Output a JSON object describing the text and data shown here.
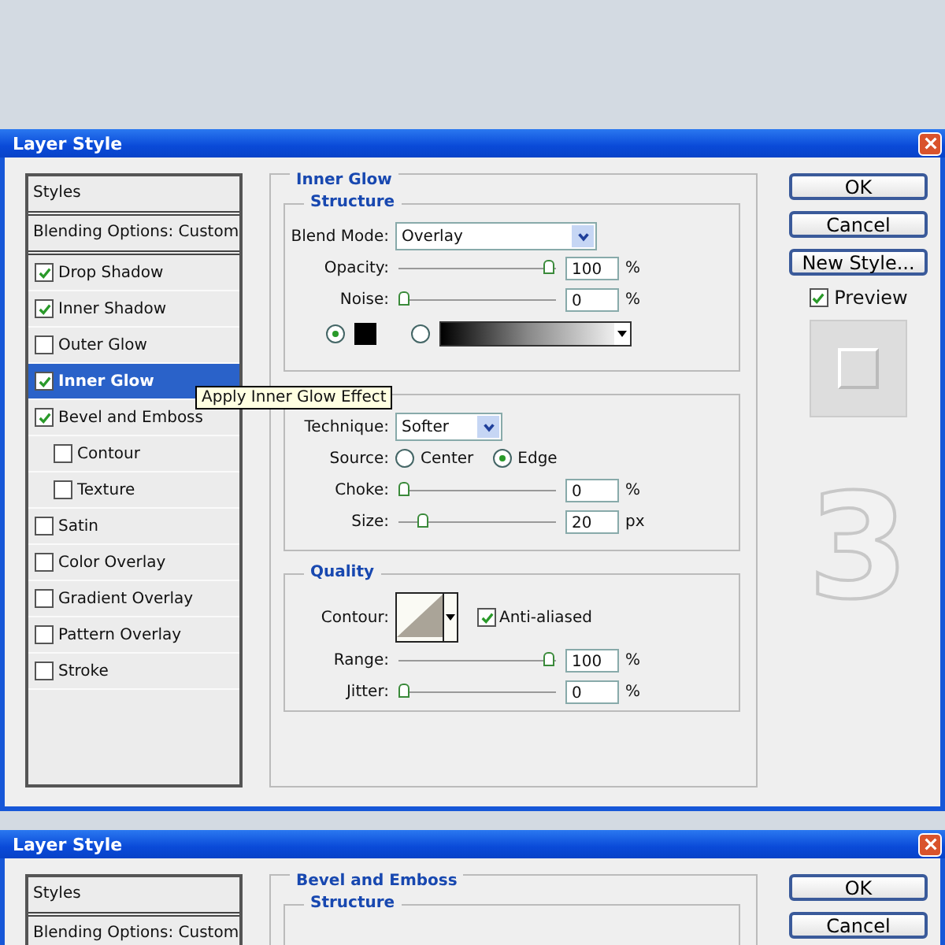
{
  "dialog": {
    "title": "Layer Style",
    "list_headers": [
      {
        "label": "Styles"
      },
      {
        "label": "Blending Options: Custom"
      }
    ],
    "effects": [
      {
        "label": "Drop Shadow",
        "checked": true,
        "selected": false
      },
      {
        "label": "Inner Shadow",
        "checked": true,
        "selected": false
      },
      {
        "label": "Outer Glow",
        "checked": false,
        "selected": false
      },
      {
        "label": "Inner Glow",
        "checked": true,
        "selected": true
      },
      {
        "label": "Bevel and Emboss",
        "checked": true,
        "selected": false,
        "children": [
          {
            "label": "Contour",
            "checked": false,
            "selected": false
          },
          {
            "label": "Texture",
            "checked": false,
            "selected": false
          }
        ]
      },
      {
        "label": "Satin",
        "checked": false,
        "selected": false
      },
      {
        "label": "Color Overlay",
        "checked": false,
        "selected": false
      },
      {
        "label": "Gradient Overlay",
        "checked": false,
        "selected": false
      },
      {
        "label": "Pattern Overlay",
        "checked": false,
        "selected": false
      },
      {
        "label": "Stroke",
        "checked": false,
        "selected": false
      }
    ],
    "tooltip": "Apply Inner Glow Effect",
    "section_title": "Inner Glow",
    "structure": {
      "title": "Structure",
      "blend_mode_label": "Blend Mode:",
      "blend_mode": "Overlay",
      "sliders": [
        {
          "label": "Opacity:",
          "level": 1,
          "value": "100",
          "unit": "%"
        },
        {
          "label": "Noise:",
          "level": 0,
          "value": "0",
          "unit": "%"
        }
      ],
      "fill_options": [
        {
          "kind": "color",
          "selected": true
        },
        {
          "kind": "gradient",
          "selected": false
        }
      ]
    },
    "elements": {
      "technique_label": "Technique:",
      "technique": "Softer",
      "source_label": "Source:",
      "sources": [
        {
          "label": "Center",
          "selected": false
        },
        {
          "label": "Edge",
          "selected": true
        }
      ],
      "sliders": [
        {
          "label": "Choke:",
          "level": 0,
          "value": "0",
          "unit": "%"
        },
        {
          "label": "Size:",
          "level": 0.13,
          "value": "20",
          "unit": "px"
        }
      ]
    },
    "quality": {
      "title": "Quality",
      "contour_label": "Contour:",
      "anti_aliased": {
        "label": "Anti-aliased",
        "checked": true
      },
      "sliders": [
        {
          "label": "Range:",
          "level": 1,
          "value": "100",
          "unit": "%"
        },
        {
          "label": "Jitter:",
          "level": 0,
          "value": "0",
          "unit": "%"
        }
      ]
    },
    "buttons": [
      "OK",
      "Cancel",
      "New Style..."
    ],
    "preview": {
      "label": "Preview",
      "checked": true
    }
  },
  "step_number": "3",
  "second_dialog": {
    "title": "Layer Style",
    "list_headers": [
      {
        "label": "Styles"
      },
      {
        "label": "Blending Options: Custom"
      }
    ],
    "section_title": "Bevel and Emboss",
    "group_title": "Structure",
    "buttons": [
      "OK",
      "Cancel"
    ]
  }
}
